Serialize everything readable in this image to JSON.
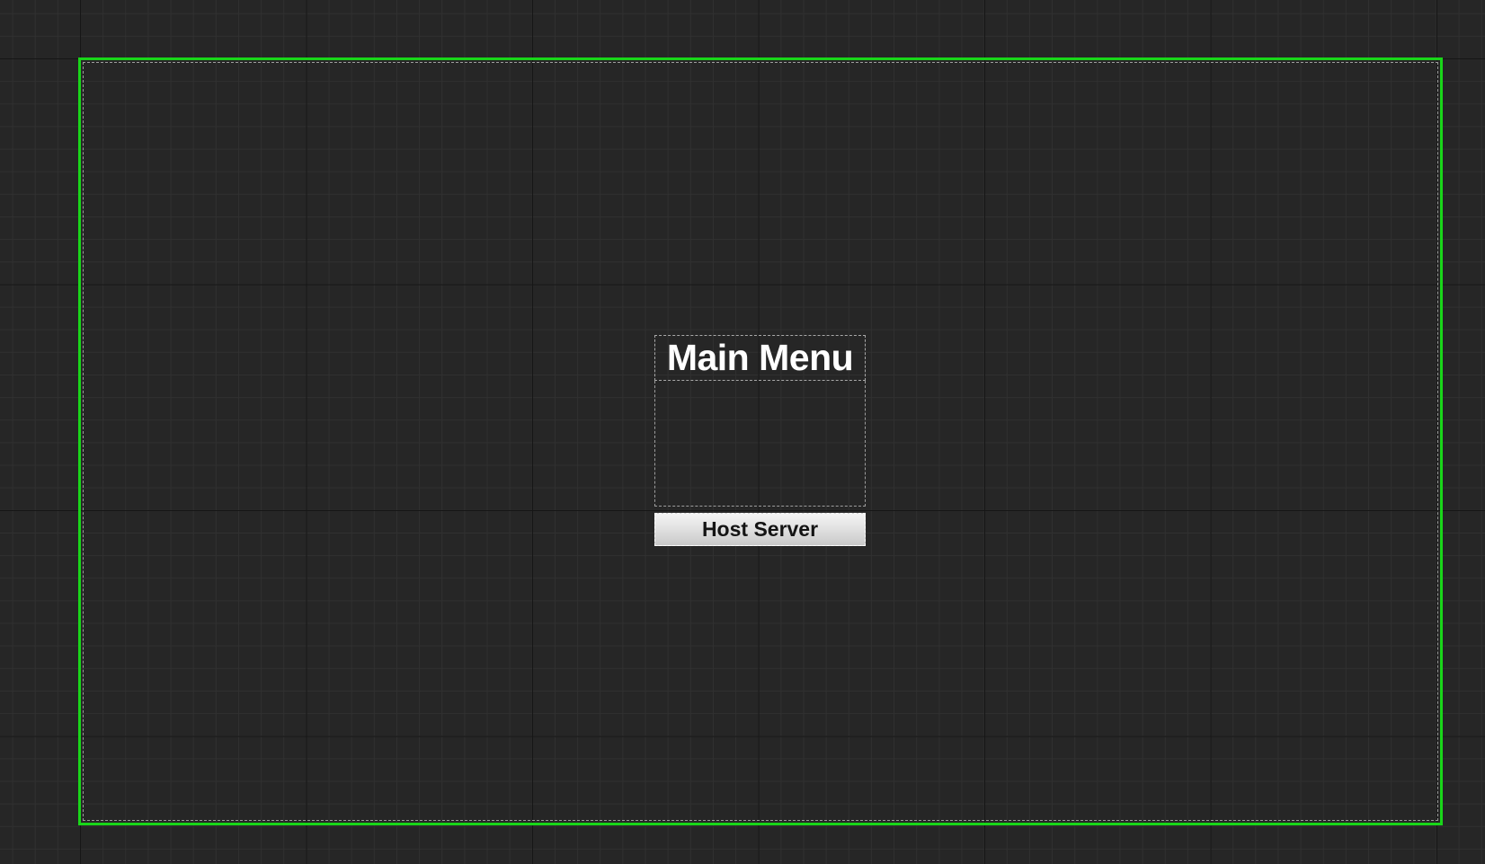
{
  "canvas": {
    "grid_color": "#262626",
    "screen_bounds_color": "#19d619"
  },
  "main_menu": {
    "title": "Main Menu",
    "host_button_label": "Host Server"
  }
}
